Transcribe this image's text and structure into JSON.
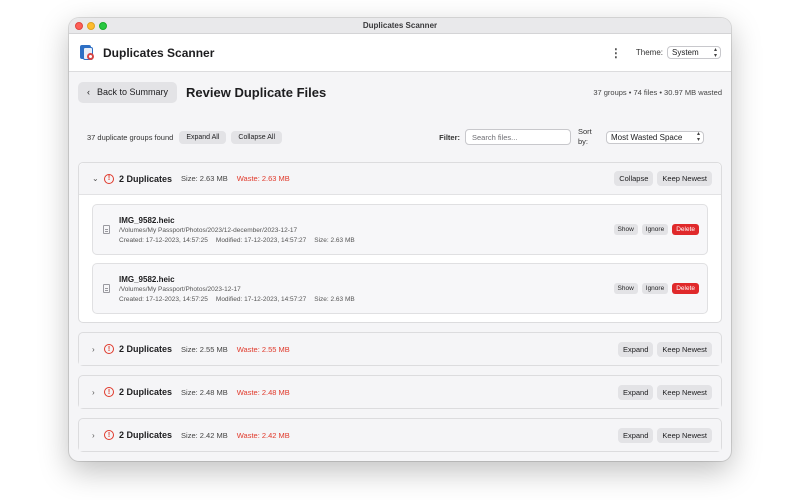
{
  "window": {
    "title": "Duplicates Scanner"
  },
  "header": {
    "app_title": "Duplicates Scanner",
    "theme_label": "Theme:",
    "theme_value": "System"
  },
  "topbar": {
    "back_label": "Back to Summary",
    "page_title": "Review Duplicate Files",
    "stats": "37 groups • 74 files • 30.97 MB wasted"
  },
  "toolbar": {
    "groups_found": "37 duplicate groups found",
    "expand_all": "Expand All",
    "collapse_all": "Collapse All",
    "filter_label": "Filter:",
    "search_placeholder": "Search files...",
    "sort_label": "Sort by:",
    "sort_value": "Most Wasted Space"
  },
  "groups": [
    {
      "title": "2 Duplicates",
      "size": "Size: 2.63 MB",
      "waste": "Waste: 2.63 MB",
      "toggle_label": "Collapse",
      "keep_label": "Keep Newest",
      "files": [
        {
          "name": "IMG_9582.heic",
          "path": "/Volumes/My Passport/Photos/2023/12-december/2023-12-17",
          "created": "Created: 17-12-2023, 14:57:25",
          "modified": "Modified: 17-12-2023, 14:57:27",
          "size": "Size: 2.63 MB",
          "show": "Show",
          "ignore": "Ignore",
          "delete": "Delete"
        },
        {
          "name": "IMG_9582.heic",
          "path": "/Volumes/My Passport/Photos/2023-12-17",
          "created": "Created: 17-12-2023, 14:57:25",
          "modified": "Modified: 17-12-2023, 14:57:27",
          "size": "Size: 2.63 MB",
          "show": "Show",
          "ignore": "Ignore",
          "delete": "Delete"
        }
      ]
    },
    {
      "title": "2 Duplicates",
      "size": "Size: 2.55 MB",
      "waste": "Waste: 2.55 MB",
      "toggle_label": "Expand",
      "keep_label": "Keep Newest"
    },
    {
      "title": "2 Duplicates",
      "size": "Size: 2.48 MB",
      "waste": "Waste: 2.48 MB",
      "toggle_label": "Expand",
      "keep_label": "Keep Newest"
    },
    {
      "title": "2 Duplicates",
      "size": "Size: 2.42 MB",
      "waste": "Waste: 2.42 MB",
      "toggle_label": "Expand",
      "keep_label": "Keep Newest"
    }
  ],
  "colors": {
    "danger": "#e0292b",
    "waste_text": "#e0392b",
    "button_bg": "#e3e3e6"
  }
}
